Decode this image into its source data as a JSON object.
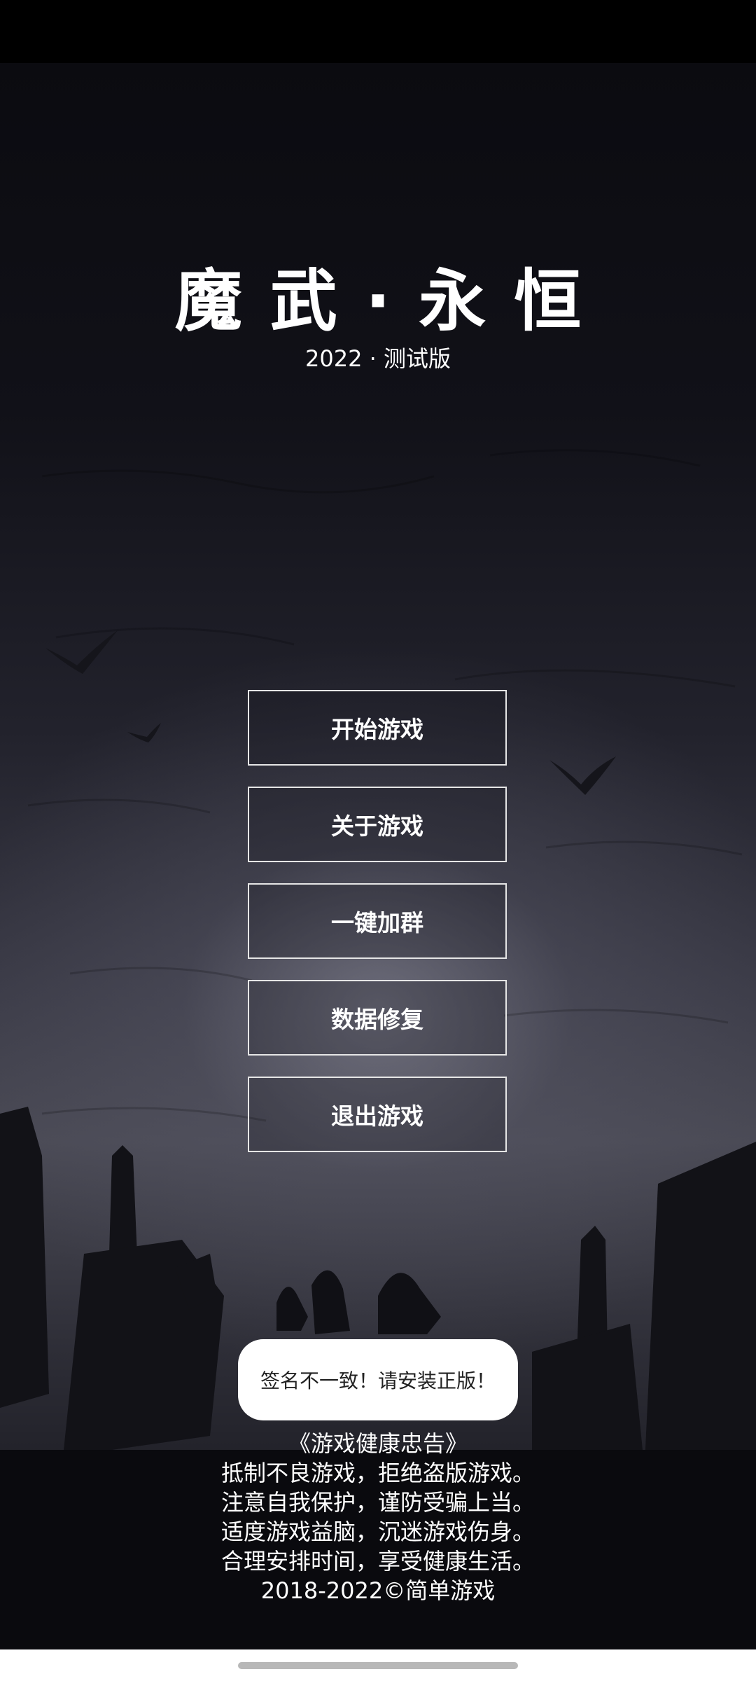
{
  "game": {
    "title": "魔武·永恒",
    "subtitle": "2022 · 测试版"
  },
  "menu": {
    "start": "开始游戏",
    "about": "关于游戏",
    "join_group": "一键加群",
    "repair": "数据修复",
    "exit": "退出游戏"
  },
  "toast": {
    "message": "签名不一致！请安装正版！"
  },
  "health_notice": {
    "heading": "《游戏健康忠告》",
    "line1": "抵制不良游戏，拒绝盗版游戏。",
    "line2": "注意自我保护，谨防受骗上当。",
    "line3": "适度游戏益脑，沉迷游戏伤身。",
    "line4": "合理安排时间，享受健康生活。",
    "copyright": "2018-2022©简单游戏"
  },
  "colors": {
    "background_top": "#0b0b10",
    "background_glow": "#4a4a55",
    "button_border": "#e6e6e6",
    "toast_bg": "#ffffff"
  }
}
